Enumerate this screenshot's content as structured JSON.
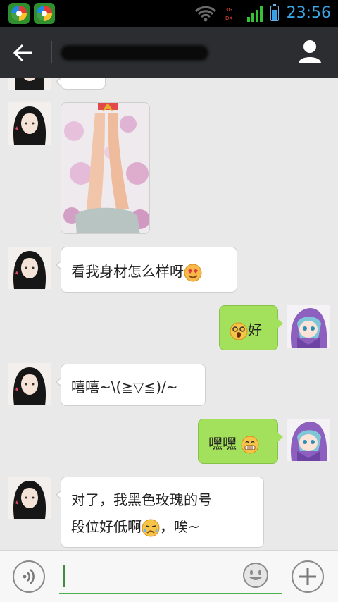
{
  "status_bar": {
    "time": "23:56",
    "net_top": "3G",
    "net_bottom": "DX"
  },
  "header": {
    "back_icon": "arrow-left-icon",
    "profile_icon": "person-icon"
  },
  "messages": [
    {
      "side": "left",
      "type": "image",
      "emoji": null
    },
    {
      "side": "left",
      "type": "text",
      "text": "看我身材怎么样呀",
      "emoji": "heart-eyes-emoji"
    },
    {
      "side": "right",
      "type": "text",
      "text": "好",
      "emoji": "dizzy-face-emoji"
    },
    {
      "side": "left",
      "type": "text",
      "text": "嘻嘻~\\(≧▽≦)/~"
    },
    {
      "side": "right",
      "type": "text",
      "text": "嘿嘿",
      "emoji": "grin-emoji"
    },
    {
      "side": "left",
      "type": "text",
      "line1": "对了，我黑色玫瑰的号",
      "line2_before": "段位好低啊",
      "line2_after": "，唉~",
      "emoji": "crying-emoji"
    }
  ],
  "input_bar": {
    "placeholder": "",
    "voice_icon": "voice-icon",
    "emoji_icon": "smiley-icon",
    "plus_icon": "plus-icon"
  },
  "colors": {
    "header_bg": "#2b2d31",
    "chat_bg": "#e9e9e9",
    "outgoing_bubble": "#a3e05b",
    "incoming_bubble": "#ffffff",
    "clock": "#3aa6e6"
  }
}
